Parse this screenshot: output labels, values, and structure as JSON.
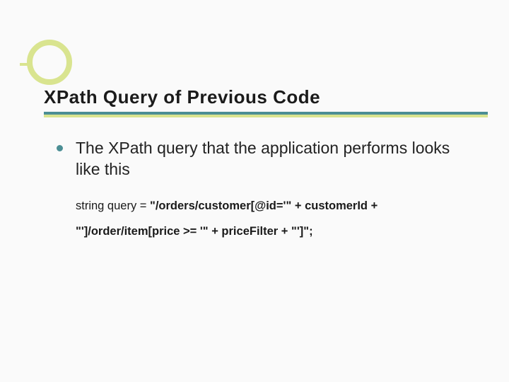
{
  "title": "XPath Query of Previous Code",
  "bullet": {
    "text": "The XPath query that the application performs looks like this"
  },
  "code": {
    "line1_a": "string query = ",
    "line1_b": "\"/orders/customer[@id='\" + customerId +",
    "line2": "\"']/order/item[price >= '\" + priceFilter + \"']\";"
  }
}
